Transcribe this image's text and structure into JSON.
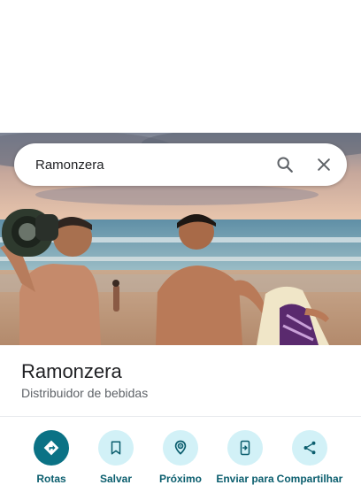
{
  "search": {
    "query": "Ramonzera"
  },
  "place": {
    "name": "Ramonzera",
    "category": "Distribuidor de bebidas"
  },
  "actions": [
    {
      "label": "Rotas",
      "icon": "directions-icon"
    },
    {
      "label": "Salvar",
      "icon": "bookmark-icon"
    },
    {
      "label": "Próximo",
      "icon": "nearby-icon"
    },
    {
      "label": "Enviar para",
      "icon": "send-to-phone-icon"
    },
    {
      "label": "Compartilhar",
      "icon": "share-icon"
    }
  ],
  "colors": {
    "accent": "#0b7285",
    "action_bg": "#d2f1f7",
    "action_text": "#0b5e6e"
  }
}
